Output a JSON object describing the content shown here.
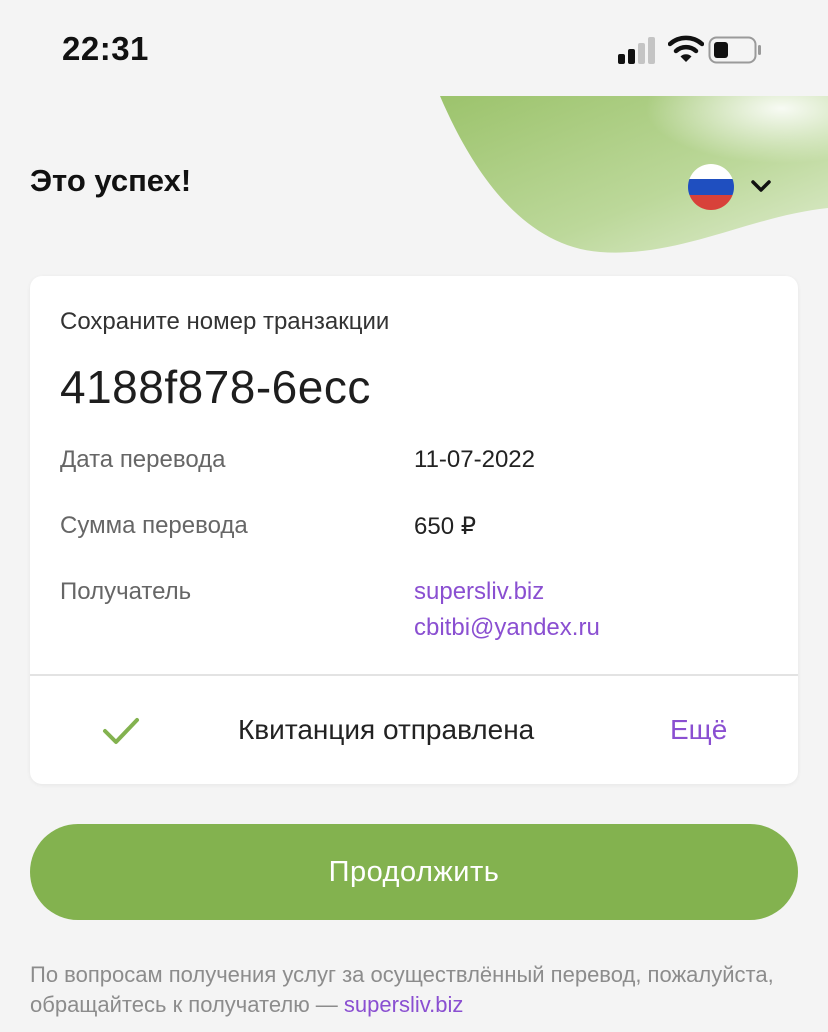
{
  "status_bar": {
    "time": "22:31",
    "icons": [
      "signal-icon",
      "wifi-icon",
      "battery-icon"
    ]
  },
  "header": {
    "title": "Это успех!",
    "language_flag": "russia-flag-icon",
    "dropdown_icon": "chevron-down-icon"
  },
  "card": {
    "caption": "Сохраните номер транзакции",
    "transaction_id": "4188f878-6ecc",
    "rows": [
      {
        "label": "Дата перевода",
        "value": "11-07-2022"
      },
      {
        "label": "Сумма перевода",
        "value": "650 ₽"
      },
      {
        "label": "Получатель",
        "values": [
          "supersliv.biz",
          "cbitbi@yandex.ru"
        ]
      }
    ],
    "receipt_status": "Квитанция отправлена",
    "more_label": "Ещё"
  },
  "continue_button": "Продолжить",
  "footer": {
    "text": "По вопросам получения услуг за осуществлённый перевод, пожалуйста, обращайтесь к получателю — ",
    "link": "supersliv.biz"
  },
  "colors": {
    "accent_green": "#83b24f",
    "link_purple": "#8a4fd1",
    "background": "#f4f4f4",
    "flag_white": "#ffffff",
    "flag_blue": "#1f4fc0",
    "flag_red": "#d8413a"
  }
}
